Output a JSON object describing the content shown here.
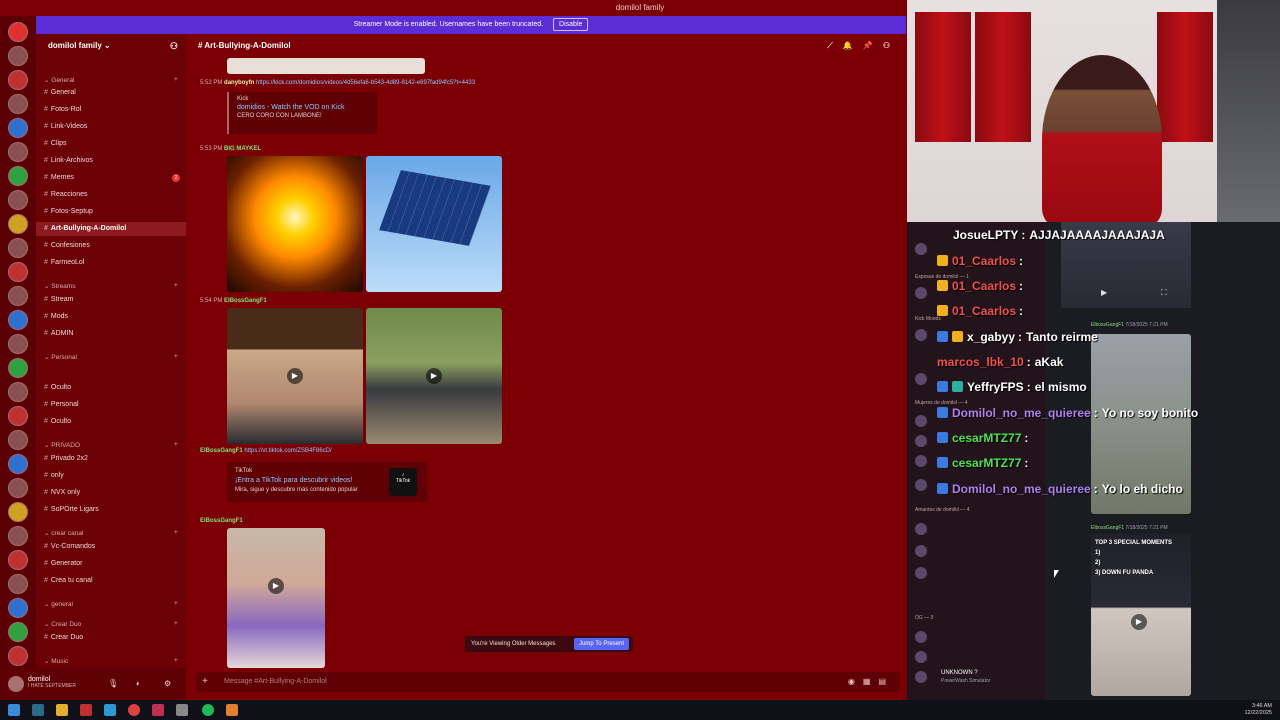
{
  "window": {
    "title": "domilol family"
  },
  "banner": {
    "text": "Streamer Mode is enabled. Usernames have been truncated.",
    "disable_label": "Disable"
  },
  "server": {
    "name": "domilol family"
  },
  "sidebar": {
    "categories": [
      {
        "label": "General"
      },
      {
        "label": "Streams"
      },
      {
        "label": "Personal"
      },
      {
        "label": "PRIVADO"
      },
      {
        "label": "crear canal"
      },
      {
        "label": "general"
      },
      {
        "label": "Crear Duo"
      },
      {
        "label": "Music"
      }
    ],
    "channels": [
      {
        "label": "General"
      },
      {
        "label": "Fotos-Rol"
      },
      {
        "label": "Link-Videos"
      },
      {
        "label": "Clips"
      },
      {
        "label": "Link-Archivos"
      },
      {
        "label": "Memes",
        "badge": "2"
      },
      {
        "label": "Reacciones"
      },
      {
        "label": "Fotos-Septup"
      },
      {
        "label": "Art-Bullying-A-Domilol"
      },
      {
        "label": "Confesiones"
      },
      {
        "label": "FarmeoLol"
      },
      {
        "label": "Stream"
      },
      {
        "label": "Mods"
      },
      {
        "label": "ADMIN"
      },
      {
        "label": "Oculto"
      },
      {
        "label": "Personal"
      },
      {
        "label": "Oculto"
      },
      {
        "label": "Privado 2x2"
      },
      {
        "label": "only"
      },
      {
        "label": "NVX only"
      },
      {
        "label": "SoPOrte Ligars"
      },
      {
        "label": "Vc-Comandos"
      },
      {
        "label": "Generator"
      },
      {
        "label": "Crea tu canal"
      },
      {
        "label": "Crear Duo"
      }
    ]
  },
  "user": {
    "name": "domilol",
    "status": "I HATE SEPTEMBER"
  },
  "chat": {
    "channel_title": "Art-Bullying-A-Domilol",
    "messages": [
      {
        "time": "5:52 PM",
        "author": "danyboyfn",
        "link": "https://kick.com/domidios/videos/4d56efa6-b543-4d89-8142-e697fad94fc5?t=4433"
      },
      {
        "embed_source": "Kick",
        "embed_title": "domidios - Watch the VOD on Kick",
        "embed_desc": "CERO CORO CON LAMBONE!"
      },
      {
        "time": "5:53 PM",
        "author": "BIG MAYKEL"
      },
      {
        "time": "5:54 PM",
        "author": "ElBossGangF1"
      },
      {
        "author": "ElBossGangF1",
        "link": "https://vt.tiktok.com/ZSB4F86cD/"
      },
      {
        "embed_source": "TikTok",
        "embed_title": "¡Entra a TikTok para descubrir videos!",
        "embed_desc": "Mira, sigue y descubre más contenido popular",
        "logo": "TikTok"
      },
      {
        "author": "ElBossGangF1"
      }
    ],
    "older_notice": "You're Viewing Older Messages",
    "jump_label": "Jump To Present",
    "composer_placeholder": "Message #Art-Bullying-A-Domilol"
  },
  "overlay": {
    "member_groups": [
      "Esposas de domilol — 1",
      "Kick Moods",
      "Mujeres de domilol — 4",
      "Amantes de domilol — 4",
      "OG — 3"
    ],
    "members": [
      "UNKNOWN ?",
      "PowerWash Simulator"
    ],
    "clips": [
      {
        "author": "ElbossGangF1",
        "time": "7/18/2025 7:21 PM"
      },
      {
        "author": "ElbossGangF1",
        "time": "7/18/2025 7:21 PM"
      }
    ],
    "clip_text": [
      "TOP 3 SPECIAL MOMENTS",
      "1)",
      "2)",
      "3) DOWN FU PANDA"
    ],
    "live_chat": [
      {
        "user": "JosueLPTY",
        "msg": "AJJAJAAAAJAAAJAJA"
      },
      {
        "user": "01_Caarlos",
        "msg": ""
      },
      {
        "user": "01_Caarlos",
        "msg": ""
      },
      {
        "user": "01_Caarlos",
        "msg": ""
      },
      {
        "user": "x_gabyy",
        "msg": "Tanto reirme"
      },
      {
        "user": "marcos_lbk_10",
        "msg": "aKak"
      },
      {
        "user": "YeffryFPS",
        "msg": "el mismo"
      },
      {
        "user": "Domilol_no_me_quieree",
        "msg": "Yo no soy bonito"
      },
      {
        "user": "cesarMTZ77",
        "msg": ""
      },
      {
        "user": "cesarMTZ77",
        "msg": ""
      },
      {
        "user": "Domilol_no_me_quieree",
        "msg": "Yo lo eh dicho"
      }
    ]
  },
  "taskbar": {
    "time": "3:46 AM",
    "date": "12/22/2025"
  },
  "colors": {
    "app_bg": "#7a0006",
    "banner": "#5b2dd6",
    "accent": "#5865f2"
  }
}
